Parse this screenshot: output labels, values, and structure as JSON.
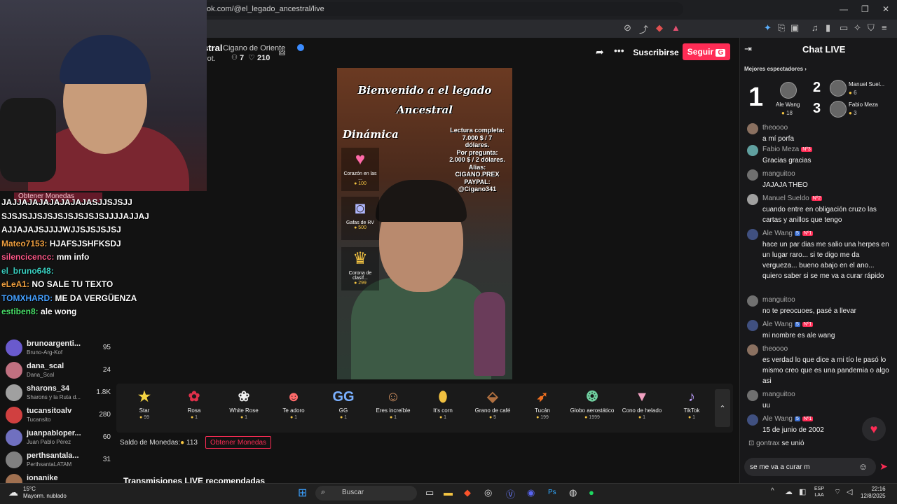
{
  "browser": {
    "url": "tok.com/@el_legado_ancestral/live",
    "new_tab": "+",
    "close_tab": "×"
  },
  "stream": {
    "host_name": "stral",
    "host_sub": "Cigano de Oriente",
    "host_meta": "rot.",
    "viewers": "7",
    "likes": "210",
    "subscribe_label": "Suscribirse",
    "follow_label": "Seguir",
    "follow_letter": "G"
  },
  "video": {
    "title_line1": "Bienvenido a el legado",
    "title_line2": "Ancestral",
    "dinamica": "Dinámica",
    "info_lines": [
      "Lectura completa:",
      "7.000 $ / 7",
      "dólares.",
      "Por pregunta:",
      "2.000 $ / 2 dólares.",
      "Alias:",
      "CIGANO.PREX",
      "PAYPAL:",
      "@Cigano341"
    ],
    "gifts": [
      {
        "name": "Corazón en las ...",
        "price": "100",
        "icon": "heart-icon"
      },
      {
        "name": "Gafas de RV",
        "price": "500",
        "icon": "vr-goggles-icon"
      },
      {
        "name": "Corona de clasif...",
        "price": "299",
        "icon": "crown-icon"
      }
    ]
  },
  "gifts_bar": [
    {
      "name": "Star",
      "price": "99",
      "icon": "star-icon"
    },
    {
      "name": "Rosa",
      "price": "1",
      "icon": "rose-icon"
    },
    {
      "name": "White Rose",
      "price": "1",
      "icon": "white-rose-icon"
    },
    {
      "name": "Te adoro",
      "price": "1",
      "icon": "heart-face-icon"
    },
    {
      "name": "GG",
      "price": "1",
      "icon": "gg-icon"
    },
    {
      "name": "Eres increíble",
      "price": "1",
      "icon": "cat-icon"
    },
    {
      "name": "It's corn",
      "price": "1",
      "icon": "corn-icon"
    },
    {
      "name": "Grano de café",
      "price": "5",
      "icon": "coffee-icon"
    },
    {
      "name": "Tucán",
      "price": "199",
      "icon": "toucan-icon"
    },
    {
      "name": "Globo aerostático",
      "price": "1999",
      "icon": "balloon-icon"
    },
    {
      "name": "Cono de helado",
      "price": "1",
      "icon": "ice-cream-icon"
    },
    {
      "name": "TikTok",
      "price": "1",
      "icon": "tiktok-icon"
    }
  ],
  "balance_label": "Saldo de Monedas:",
  "balance_value": "113",
  "get_coins": "Obtener Monedas",
  "recommended_title": "Transmisiones LIVE recomendadas",
  "sidebar": [
    {
      "name": "brunoargenti...",
      "sub": "Bruno-Arg-Kof",
      "count": "95"
    },
    {
      "name": "dana_scal",
      "sub": "Dana_Scal",
      "count": "24"
    },
    {
      "name": "sharons_34",
      "sub": "Sharons y la Ruta d...",
      "count": "1.8K"
    },
    {
      "name": "tucansitoalv",
      "sub": "Tucansito",
      "count": "280"
    },
    {
      "name": "juanpabloper...",
      "sub": "Juan Pablo Pérez",
      "count": "60"
    },
    {
      "name": "perthsantala...",
      "sub": "PerthsantaLATAM",
      "count": "31"
    },
    {
      "name": "ionanike",
      "sub": "",
      "count": ""
    }
  ],
  "overlay_chat": {
    "faded": "Obtener Monedas",
    "lines": [
      {
        "user": "",
        "text": "JAJJAJAJAJAJAJAJASJJSJSJJ SJSJSJJSJSJSJSJSJSJSJJJJAJJAJ AJJAJAJSJJJJWJJSJSJSJSJ"
      },
      {
        "user": "Mateo7153: ",
        "text": "HJAFSJSHFKSDJ",
        "cls": "u1"
      },
      {
        "user": "silencicencc: ",
        "text": "mm info",
        "cls": "u3"
      },
      {
        "user": "el_bruno648: ",
        "text": "",
        "cls": "u2"
      },
      {
        "user": "eLeA1: ",
        "text": "NO SALE TU TEXTO",
        "cls": "u1"
      },
      {
        "user": "TOMXHARD: ",
        "text": "ME DA VERGÜENZA",
        "cls": "u4"
      },
      {
        "user": "estiben8: ",
        "text": "ale wong",
        "cls": "u5"
      }
    ]
  },
  "chat": {
    "title": "Chat LIVE",
    "top_viewers_label": "Mejores espectadores",
    "top": [
      {
        "rank": "1",
        "name": "Ale Wang",
        "coins": "18"
      },
      {
        "rank": "2",
        "name": "Manuel Suel...",
        "coins": "6"
      },
      {
        "rank": "3",
        "name": "Fabio Meza",
        "coins": "3"
      }
    ],
    "messages": [
      {
        "user": "theoooo",
        "text": "a mí porfa",
        "badges": []
      },
      {
        "user": "Fabio Meza",
        "text": "Gracias gracias",
        "badges": [
          "Nº3"
        ]
      },
      {
        "user": "manguitoo",
        "text": "JAJAJA THEO",
        "badges": []
      },
      {
        "user": "Manuel Sueldo",
        "text": "cuando entre en obligación cruzo las cartas y anillos que tengo",
        "badges": [
          "Nº2"
        ]
      },
      {
        "user": "Ale Wang",
        "text": "hace un par dias me salio una herpes en un lugar raro... si te digo me da vergueza... bueno abajo en el ano... quiero saber si se me va a curar rápido",
        "badges": [
          "5",
          "Nº1"
        ]
      },
      {
        "user": "manguitoo",
        "text": "no te preocuoes, pasé a llevar",
        "badges": []
      },
      {
        "user": "Ale Wang",
        "text": "mi nombre es ale wang",
        "badges": [
          "5",
          "Nº1"
        ]
      },
      {
        "user": "theoooo",
        "text": "es verdad lo que dice a mi tío le pasó lo mismo creo que es una pandemia o algo asi",
        "badges": []
      },
      {
        "user": "manguitoo",
        "text": "uu",
        "badges": []
      },
      {
        "user": "Ale Wang",
        "text": "15 de junio de 2002",
        "badges": [
          "5",
          "Nº1"
        ]
      }
    ],
    "join_user": "gontrax",
    "join_text": "se unió",
    "input_value": "se me va a curar m"
  },
  "taskbar": {
    "temp": "15°C",
    "weather": "Mayorm. nublado",
    "search": "Buscar",
    "lang1": "ESP",
    "lang2": "LAA",
    "time": "22:16",
    "date": "12/8/2025"
  }
}
